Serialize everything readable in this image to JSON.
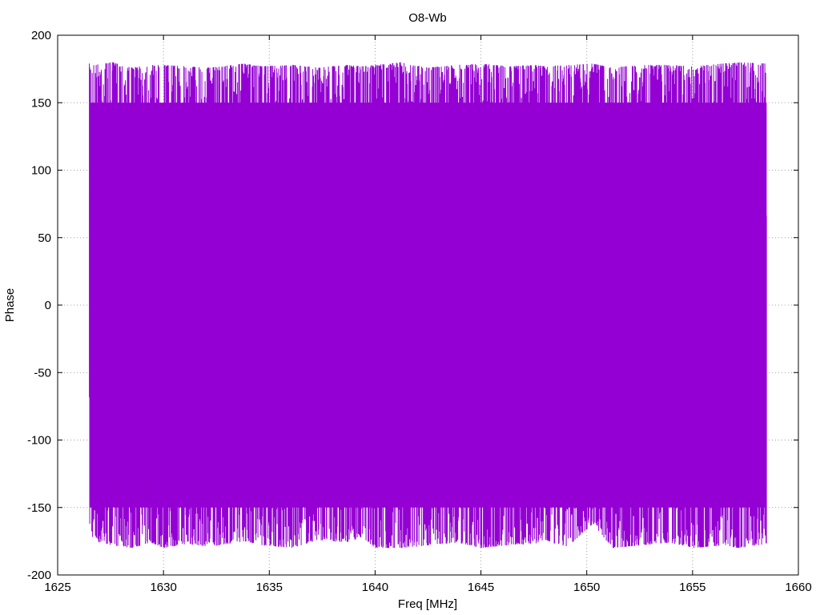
{
  "chart_data": {
    "type": "line",
    "title": "O8-Wb",
    "xlabel": "Freq [MHz]",
    "ylabel": "Phase",
    "xlim": [
      1625,
      1660
    ],
    "ylim": [
      -200,
      200
    ],
    "xticks": [
      1625,
      1630,
      1635,
      1640,
      1645,
      1650,
      1655,
      1660
    ],
    "yticks": [
      -200,
      -150,
      -100,
      -50,
      0,
      50,
      100,
      150,
      200
    ],
    "grid": true,
    "legend": "none",
    "series_color": "#9400d3",
    "series": [
      {
        "x_range": [
          1626.5,
          1658.5
        ],
        "phase_wrap": [
          -180,
          180
        ],
        "x": [
          1626.5,
          1626.7,
          1627.6,
          1628.5,
          1629.4,
          1630.0,
          1631.1,
          1632.2,
          1633.8,
          1634.7,
          1636.1,
          1637.3,
          1638.6,
          1639.4,
          1640.0,
          1641.2,
          1642.5,
          1643.9,
          1645.0,
          1646.3,
          1647.5,
          1648.0,
          1649.1,
          1650.3,
          1651.2,
          1652.6,
          1653.9,
          1655.1,
          1656.4,
          1657.2,
          1658.5
        ],
        "max": [
          179,
          178,
          180,
          176,
          178,
          178,
          177,
          176,
          179,
          177,
          178,
          176,
          178,
          177,
          178,
          180,
          176,
          178,
          179,
          177,
          178,
          177,
          178,
          179,
          176,
          178,
          178,
          177,
          179,
          180,
          179
        ],
        "min": [
          -162,
          -175,
          -178,
          -180,
          -176,
          -180,
          -177,
          -179,
          -175,
          -178,
          -180,
          -174,
          -176,
          -172,
          -180,
          -181,
          -178,
          -176,
          -180,
          -178,
          -177,
          -175,
          -179,
          -162,
          -180,
          -178,
          -176,
          -180,
          -178,
          -180,
          -177
        ]
      }
    ]
  }
}
